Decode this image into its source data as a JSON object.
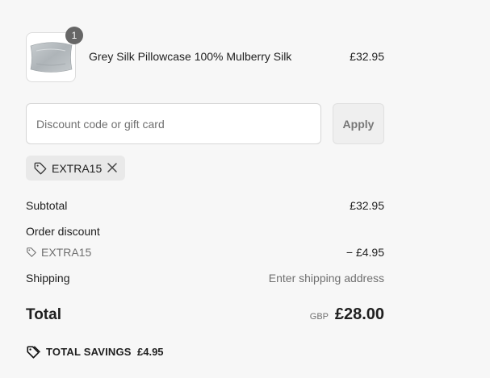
{
  "cart": {
    "item": {
      "quantity": "1",
      "name": "Grey Silk Pillowcase 100% Mulberry Silk",
      "price": "£32.95"
    }
  },
  "discount": {
    "placeholder": "Discount code or gift card",
    "apply_label": "Apply",
    "applied_code": "EXTRA15"
  },
  "summary": {
    "subtotal_label": "Subtotal",
    "subtotal_value": "£32.95",
    "order_discount_label": "Order discount",
    "discount_code": "EXTRA15",
    "discount_value": "− £4.95",
    "shipping_label": "Shipping",
    "shipping_value": "Enter shipping address",
    "total_label": "Total",
    "currency": "GBP",
    "total_value": "£28.00",
    "savings_label": "TOTAL SAVINGS",
    "savings_value": "£4.95"
  },
  "icons": {
    "tag": "tag-icon",
    "close": "close-icon",
    "savings": "tag-icon"
  },
  "colors": {
    "background": "#f7f7f7",
    "badge": "#666666",
    "muted_text": "#707070",
    "apply_button_bg": "#efefef"
  }
}
